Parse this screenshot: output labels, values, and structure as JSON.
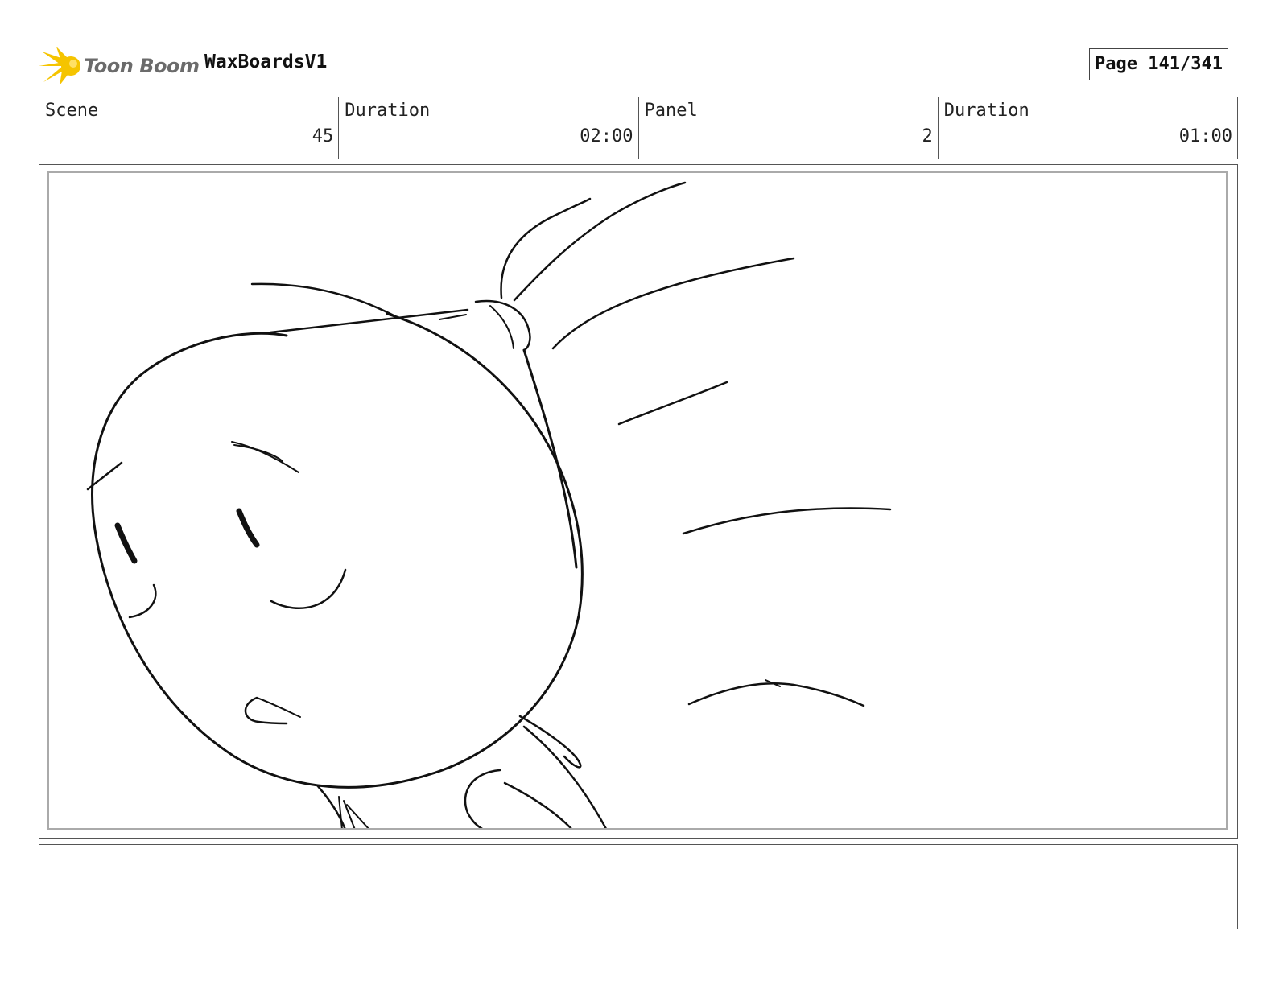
{
  "header": {
    "logo_text": "Toon Boom",
    "project_title": "WaxBoardsV1",
    "page_label": "Page 141/341"
  },
  "info": {
    "scene_label": "Scene",
    "scene_value": "45",
    "scene_duration_label": "Duration",
    "scene_duration_value": "02:00",
    "panel_label": "Panel",
    "panel_value": "2",
    "panel_duration_label": "Duration",
    "panel_duration_value": "01:00"
  },
  "colors": {
    "logo_star": "#f5c400",
    "logo_text": "#6b6b6b",
    "border": "#555555",
    "inner_border": "#aaaaaa",
    "sketch_stroke": "#111111"
  },
  "icons": {
    "logo": "toon-boom-star-icon"
  },
  "notes": {
    "text": ""
  }
}
